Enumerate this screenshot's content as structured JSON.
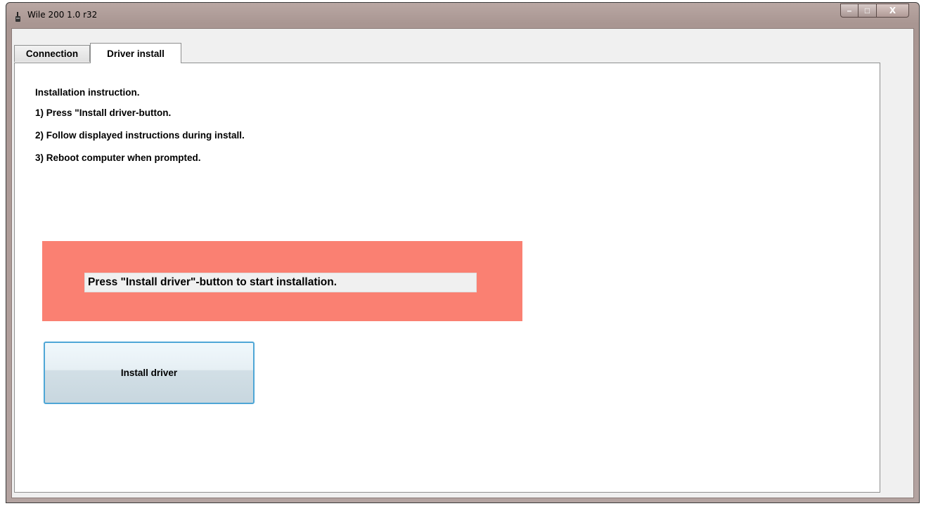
{
  "window": {
    "title": "Wile 200 1.0 r32",
    "caption_buttons": {
      "minimize": "–",
      "maximize": "□",
      "close": "X"
    }
  },
  "tabs": [
    {
      "label": "Connection",
      "selected": false
    },
    {
      "label": "Driver install",
      "selected": true
    }
  ],
  "instructions": {
    "heading": "Installation instruction.",
    "steps": [
      "1) Press \"Install driver-button.",
      "2) Follow displayed instructions during install.",
      "3) Reboot computer when prompted."
    ]
  },
  "status": {
    "message": "Press \"Install driver\"-button to start installation.",
    "background_color": "#fa8072"
  },
  "install_button": {
    "label": "Install driver"
  },
  "colors": {
    "button_focus_border": "#4ea6d6",
    "panel_background": "#ffffff"
  }
}
